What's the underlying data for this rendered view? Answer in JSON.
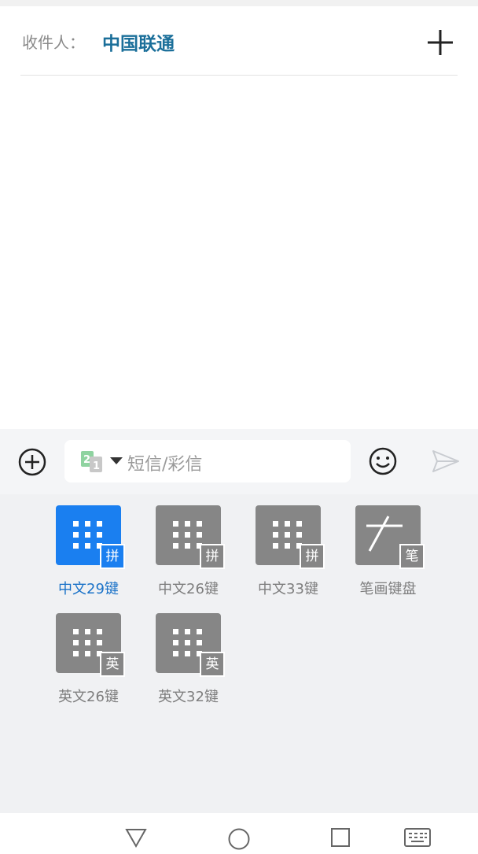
{
  "header": {
    "recipient_label": "收件人：",
    "recipient_name": "中国联通",
    "add_icon": "plus-icon"
  },
  "compose": {
    "placeholder": "短信/彩信",
    "sim_badge": "21",
    "attach_icon": "circle-plus-icon",
    "emoji_icon": "smiley-icon",
    "send_icon": "send-arrow-icon"
  },
  "keyboards": [
    {
      "label": "中文29键",
      "badge": "拼",
      "active": true
    },
    {
      "label": "中文26键",
      "badge": "拼",
      "active": false
    },
    {
      "label": "中文33键",
      "badge": "拼",
      "active": false
    },
    {
      "label": "笔画键盘",
      "badge": "笔",
      "active": false
    },
    {
      "label": "英文26键",
      "badge": "英",
      "active": false
    },
    {
      "label": "英文32键",
      "badge": "英",
      "active": false
    }
  ],
  "navbar": {
    "back_icon": "triangle-back-icon",
    "home_icon": "circle-home-icon",
    "recents_icon": "square-recents-icon",
    "keyboard_icon": "keyboard-icon"
  },
  "colors": {
    "accent": "#1a7ff0",
    "recipient": "#1b6f9a",
    "tile_gray": "#868686"
  }
}
